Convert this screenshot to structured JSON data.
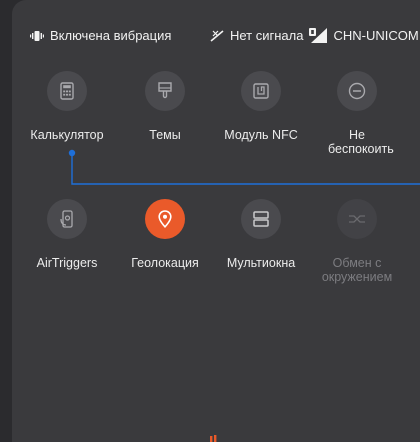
{
  "status_bar": {
    "vibration_text": "Включена вибрация",
    "no_signal_text": "Нет сигнала",
    "carrier_text": "CHN-UNICOM"
  },
  "tiles": [
    {
      "label": "Калькулятор",
      "icon": "calculator-icon",
      "state": "inactive"
    },
    {
      "label": "Темы",
      "icon": "brush-icon",
      "state": "inactive"
    },
    {
      "label": "Модуль NFC",
      "icon": "nfc-icon",
      "state": "inactive"
    },
    {
      "label": "Не беспокоить",
      "icon": "do-not-disturb-icon",
      "state": "inactive"
    },
    {
      "label": "AirTriggers",
      "icon": "airtriggers-icon",
      "state": "inactive"
    },
    {
      "label": "Геолокация",
      "icon": "location-pin-icon",
      "state": "active"
    },
    {
      "label": "Мультиокна",
      "icon": "multiwindow-icon",
      "state": "inactive"
    },
    {
      "label": "Обмен с окружением",
      "icon": "nearby-share-icon",
      "state": "disabled"
    }
  ],
  "colors": {
    "background": "#2b2b2e",
    "panel": "#3a3a3d",
    "tile_inactive": "#4a4a4e",
    "tile_active": "#ea5a2a",
    "annotation_line": "#1e6fd9"
  }
}
